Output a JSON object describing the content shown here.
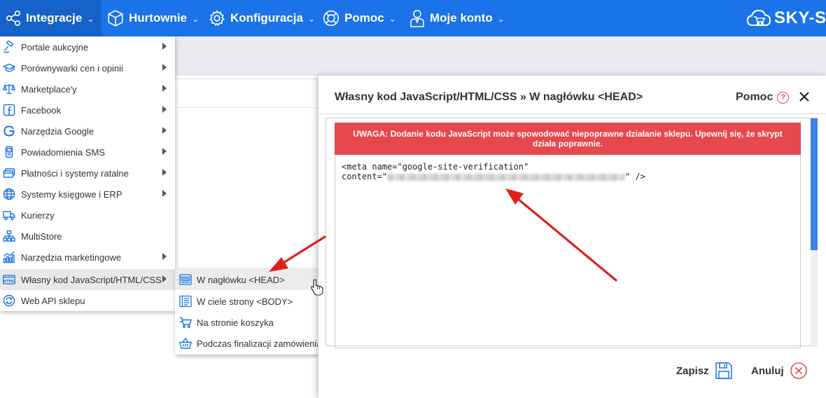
{
  "nav": {
    "items": [
      {
        "label": "Integracje",
        "icon": "share-nodes-icon"
      },
      {
        "label": "Hurtownie",
        "icon": "box-icon"
      },
      {
        "label": "Konfiguracja",
        "icon": "gear-icon"
      },
      {
        "label": "Pomoc",
        "icon": "lifebuoy-icon"
      },
      {
        "label": "Moje konto",
        "icon": "user-icon"
      }
    ],
    "brand": "SKY-S",
    "chevron": "⌄"
  },
  "menu": {
    "items": [
      {
        "label": "Portale aukcyjne",
        "icon": "gavel-icon"
      },
      {
        "label": "Porównywarki cen i opinii",
        "icon": "graduation-cap-icon"
      },
      {
        "label": "Marketplace'y",
        "icon": "scales-icon"
      },
      {
        "label": "Facebook",
        "icon": "facebook-icon"
      },
      {
        "label": "Narzędzia Google",
        "icon": "google-icon"
      },
      {
        "label": "Powiadomienia SMS",
        "icon": "phone-icon"
      },
      {
        "label": "Płatności i systemy ratalne",
        "icon": "credit-card-icon"
      },
      {
        "label": "Systemy księgowe i ERP",
        "icon": "globe-icon"
      },
      {
        "label": "Kurierzy",
        "icon": "truck-icon"
      },
      {
        "label": "MultiStore",
        "icon": "sitemap-icon"
      },
      {
        "label": "Narzędzia marketingowe",
        "icon": "chart-icon"
      },
      {
        "label": "Własny kod JavaScript/HTML/CSS",
        "icon": "html-icon"
      },
      {
        "label": "Web API sklepu",
        "icon": "sync-icon"
      }
    ]
  },
  "submenu": {
    "items": [
      {
        "label": "W nagłówku <HEAD>",
        "icon": "header-layout-icon"
      },
      {
        "label": "W ciele strony <BODY>",
        "icon": "body-layout-icon"
      },
      {
        "label": "Na stronie koszyka",
        "icon": "cart-icon"
      },
      {
        "label": "Podczas finalizacji zamówienia (konwersja)",
        "icon": "basket-icon"
      }
    ]
  },
  "modal": {
    "title": "Własny kod JavaScript/HTML/CSS » W nagłówku <HEAD>",
    "help_label": "Pomoc",
    "help_glyph": "?",
    "warning": "UWAGA: Dodanie kodu JavaScript może spowodować niepoprawne działanie sklepu. Upewnij się, że skrypt działa poprawnie.",
    "code_line1": "<meta name=\"google-site-verification\"",
    "code_line2_start": "content=\"",
    "code_line2_end": "\" />",
    "save_label": "Zapisz",
    "cancel_label": "Anuluj"
  },
  "colors": {
    "nav_bg": "#1a73e8",
    "nav_active": "#1562c9",
    "warning_bg": "#e5484d",
    "annotation_arrow": "#e0201b",
    "scroll_thumb": "#3b82e6"
  }
}
